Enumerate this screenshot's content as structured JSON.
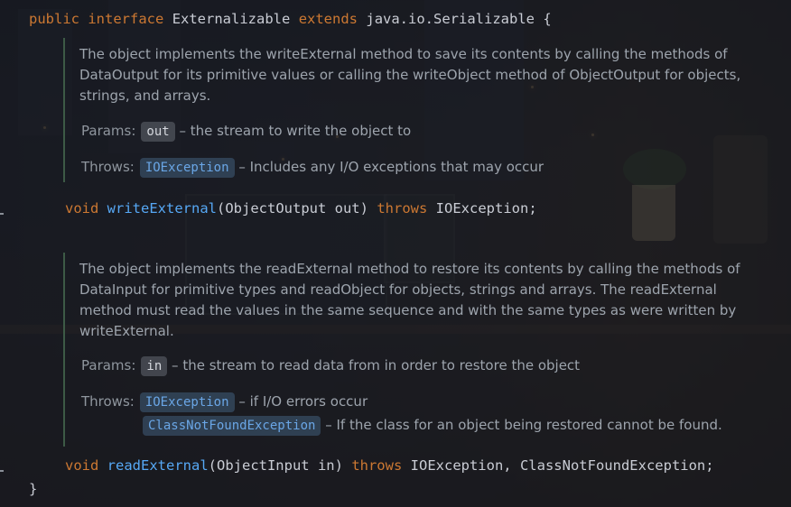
{
  "interface_decl": {
    "kw_public": "public",
    "kw_interface": "interface",
    "name": "Externalizable",
    "kw_extends": "extends",
    "parent": "java.io.Serializable",
    "open_brace": "{"
  },
  "write_doc": {
    "description": "The object implements the writeExternal method to save its contents by calling the methods of DataOutput for its primitive values or calling the writeObject method of ObjectOutput for objects, strings, and arrays.",
    "params_label": "Params:",
    "param_name": "out",
    "param_desc": "– the stream to write the object to",
    "throws_label": "Throws:",
    "throws_name": "IOException",
    "throws_desc": "– Includes any I/O exceptions that may occur"
  },
  "write_sig": {
    "kw_void": "void",
    "method": "writeExternal",
    "params": "(ObjectOutput out)",
    "kw_throws": "throws",
    "exceptions": "IOException;"
  },
  "read_doc": {
    "description": "The object implements the readExternal method to restore its contents by calling the methods of DataInput for primitive types and readObject for objects, strings and arrays. The readExternal method must read the values in the same sequence and with the same types as were written by writeExternal.",
    "params_label": "Params:",
    "param_name": "in",
    "param_desc": "– the stream to read data from in order to restore the object",
    "throws_label": "Throws:",
    "throws1_name": "IOException",
    "throws1_desc": "– if I/O errors occur",
    "throws2_name": "ClassNotFoundException",
    "throws2_desc": "– If the class for an object being restored cannot be found."
  },
  "read_sig": {
    "kw_void": "void",
    "method": "readExternal",
    "params": "(ObjectInput in)",
    "kw_throws": "throws",
    "exceptions": "IOException, ClassNotFoundException;"
  },
  "close_brace": "}",
  "colors": {
    "keyword": "#cc7832",
    "method": "#56a8f5",
    "doc_text": "#9da4ad",
    "link": "#6aa6e6",
    "doc_border": "#3d5a46"
  }
}
